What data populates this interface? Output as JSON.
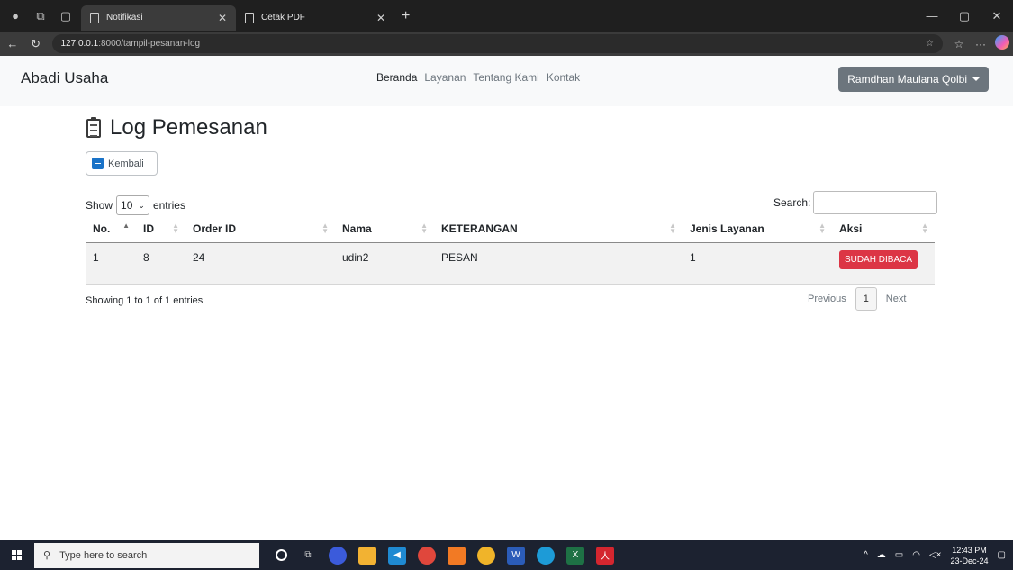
{
  "browser": {
    "tabs": [
      {
        "title": "Notifikasi",
        "active": true
      },
      {
        "title": "Cetak PDF",
        "active": false
      }
    ],
    "address": {
      "host": "127.0.0.1",
      "path": ":8000/tampil-pesanan-log"
    }
  },
  "navbar": {
    "brand": "Abadi Usaha",
    "links": [
      "Beranda",
      "Layanan",
      "Tentang Kami",
      "Kontak"
    ],
    "user": "Ramdhan Maulana Qolbi"
  },
  "page": {
    "title": "Log Pemesanan",
    "back_label": "Kembali"
  },
  "table_ctl": {
    "show": "Show",
    "entries_value": "10",
    "entries": "entries",
    "search_label": "Search:"
  },
  "table": {
    "headers": [
      "No.",
      "ID",
      "Order ID",
      "Nama",
      "KETERANGAN",
      "Jenis Layanan",
      "Aksi"
    ],
    "rows": [
      {
        "no": "1",
        "id": "8",
        "order_id": "24",
        "nama": "udin2",
        "keterangan": "PESAN",
        "jenis_layanan": "1",
        "aksi": "SUDAH DIBACA"
      }
    ]
  },
  "footer": {
    "info": "Showing 1 to 1 of 1 entries",
    "previous": "Previous",
    "page": "1",
    "next": "Next"
  },
  "taskbar": {
    "search_placeholder": "Type here to search",
    "time": "12:43 PM",
    "date": "23-Dec-24"
  }
}
